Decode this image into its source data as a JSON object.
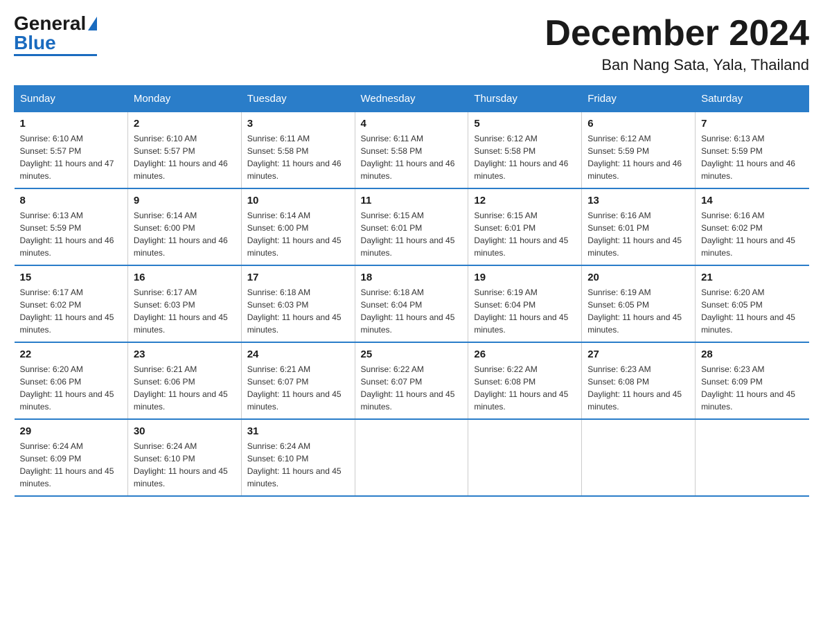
{
  "logo": {
    "general": "General",
    "blue": "Blue"
  },
  "header": {
    "month_title": "December 2024",
    "location": "Ban Nang Sata, Yala, Thailand"
  },
  "weekdays": [
    "Sunday",
    "Monday",
    "Tuesday",
    "Wednesday",
    "Thursday",
    "Friday",
    "Saturday"
  ],
  "weeks": [
    [
      {
        "day": "1",
        "sunrise": "6:10 AM",
        "sunset": "5:57 PM",
        "daylight": "11 hours and 47 minutes."
      },
      {
        "day": "2",
        "sunrise": "6:10 AM",
        "sunset": "5:57 PM",
        "daylight": "11 hours and 46 minutes."
      },
      {
        "day": "3",
        "sunrise": "6:11 AM",
        "sunset": "5:58 PM",
        "daylight": "11 hours and 46 minutes."
      },
      {
        "day": "4",
        "sunrise": "6:11 AM",
        "sunset": "5:58 PM",
        "daylight": "11 hours and 46 minutes."
      },
      {
        "day": "5",
        "sunrise": "6:12 AM",
        "sunset": "5:58 PM",
        "daylight": "11 hours and 46 minutes."
      },
      {
        "day": "6",
        "sunrise": "6:12 AM",
        "sunset": "5:59 PM",
        "daylight": "11 hours and 46 minutes."
      },
      {
        "day": "7",
        "sunrise": "6:13 AM",
        "sunset": "5:59 PM",
        "daylight": "11 hours and 46 minutes."
      }
    ],
    [
      {
        "day": "8",
        "sunrise": "6:13 AM",
        "sunset": "5:59 PM",
        "daylight": "11 hours and 46 minutes."
      },
      {
        "day": "9",
        "sunrise": "6:14 AM",
        "sunset": "6:00 PM",
        "daylight": "11 hours and 46 minutes."
      },
      {
        "day": "10",
        "sunrise": "6:14 AM",
        "sunset": "6:00 PM",
        "daylight": "11 hours and 45 minutes."
      },
      {
        "day": "11",
        "sunrise": "6:15 AM",
        "sunset": "6:01 PM",
        "daylight": "11 hours and 45 minutes."
      },
      {
        "day": "12",
        "sunrise": "6:15 AM",
        "sunset": "6:01 PM",
        "daylight": "11 hours and 45 minutes."
      },
      {
        "day": "13",
        "sunrise": "6:16 AM",
        "sunset": "6:01 PM",
        "daylight": "11 hours and 45 minutes."
      },
      {
        "day": "14",
        "sunrise": "6:16 AM",
        "sunset": "6:02 PM",
        "daylight": "11 hours and 45 minutes."
      }
    ],
    [
      {
        "day": "15",
        "sunrise": "6:17 AM",
        "sunset": "6:02 PM",
        "daylight": "11 hours and 45 minutes."
      },
      {
        "day": "16",
        "sunrise": "6:17 AM",
        "sunset": "6:03 PM",
        "daylight": "11 hours and 45 minutes."
      },
      {
        "day": "17",
        "sunrise": "6:18 AM",
        "sunset": "6:03 PM",
        "daylight": "11 hours and 45 minutes."
      },
      {
        "day": "18",
        "sunrise": "6:18 AM",
        "sunset": "6:04 PM",
        "daylight": "11 hours and 45 minutes."
      },
      {
        "day": "19",
        "sunrise": "6:19 AM",
        "sunset": "6:04 PM",
        "daylight": "11 hours and 45 minutes."
      },
      {
        "day": "20",
        "sunrise": "6:19 AM",
        "sunset": "6:05 PM",
        "daylight": "11 hours and 45 minutes."
      },
      {
        "day": "21",
        "sunrise": "6:20 AM",
        "sunset": "6:05 PM",
        "daylight": "11 hours and 45 minutes."
      }
    ],
    [
      {
        "day": "22",
        "sunrise": "6:20 AM",
        "sunset": "6:06 PM",
        "daylight": "11 hours and 45 minutes."
      },
      {
        "day": "23",
        "sunrise": "6:21 AM",
        "sunset": "6:06 PM",
        "daylight": "11 hours and 45 minutes."
      },
      {
        "day": "24",
        "sunrise": "6:21 AM",
        "sunset": "6:07 PM",
        "daylight": "11 hours and 45 minutes."
      },
      {
        "day": "25",
        "sunrise": "6:22 AM",
        "sunset": "6:07 PM",
        "daylight": "11 hours and 45 minutes."
      },
      {
        "day": "26",
        "sunrise": "6:22 AM",
        "sunset": "6:08 PM",
        "daylight": "11 hours and 45 minutes."
      },
      {
        "day": "27",
        "sunrise": "6:23 AM",
        "sunset": "6:08 PM",
        "daylight": "11 hours and 45 minutes."
      },
      {
        "day": "28",
        "sunrise": "6:23 AM",
        "sunset": "6:09 PM",
        "daylight": "11 hours and 45 minutes."
      }
    ],
    [
      {
        "day": "29",
        "sunrise": "6:24 AM",
        "sunset": "6:09 PM",
        "daylight": "11 hours and 45 minutes."
      },
      {
        "day": "30",
        "sunrise": "6:24 AM",
        "sunset": "6:10 PM",
        "daylight": "11 hours and 45 minutes."
      },
      {
        "day": "31",
        "sunrise": "6:24 AM",
        "sunset": "6:10 PM",
        "daylight": "11 hours and 45 minutes."
      },
      null,
      null,
      null,
      null
    ]
  ]
}
